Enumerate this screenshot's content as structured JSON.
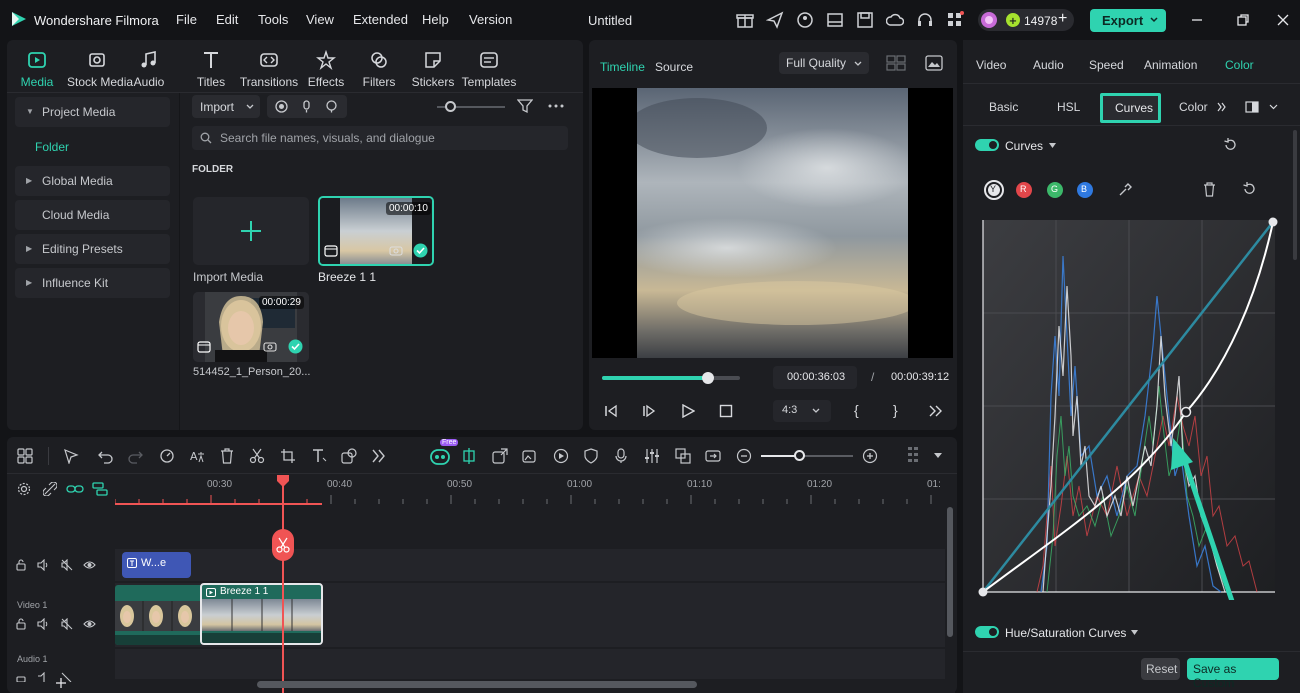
{
  "app": {
    "name": "Wondershare Filmora",
    "menu": [
      "File",
      "Edit",
      "Tools",
      "View",
      "Extended",
      "Help",
      "Version"
    ],
    "doc_title": "Untitled",
    "credits": "14978",
    "export_label": "Export"
  },
  "media": {
    "tabs": [
      "Media",
      "Stock Media",
      "Audio",
      "Titles",
      "Transitions",
      "Effects",
      "Filters",
      "Stickers",
      "Templates"
    ],
    "sidebar": [
      "Project Media",
      "Folder",
      "Global Media",
      "Cloud Media",
      "Editing Presets",
      "Influence Kit"
    ],
    "import_label": "Import",
    "search_placeholder": "Search file names, visuals, and dialogue",
    "folder_label": "FOLDER",
    "import_media_label": "Import Media",
    "clips": [
      {
        "name": "Breeze 1 1",
        "duration": "00:00:10"
      },
      {
        "name": "514452_1_Person_20...",
        "duration": "00:00:29"
      }
    ]
  },
  "player": {
    "tab_timeline": "Timeline",
    "tab_source": "Source",
    "quality": "Full Quality",
    "current_time": "00:00:36:03",
    "separator": "/",
    "total_time": "00:00:39:12",
    "aspect": "4:3",
    "progress": 0.77
  },
  "right": {
    "tabs": [
      "Video",
      "Audio",
      "Speed",
      "Animation",
      "Color"
    ],
    "subtabs": [
      "Basic",
      "HSL",
      "Curves",
      "Color"
    ],
    "curves_label": "Curves",
    "channels": [
      "Y",
      "R",
      "G",
      "B"
    ],
    "hue_sat_label": "Hue/Saturation Curves",
    "reset_label": "Reset",
    "save_custom_label": "Save as Custom"
  },
  "timeline": {
    "ticks": [
      "00:30",
      "00:40",
      "00:50",
      "01:00",
      "01:10",
      "01:20",
      "01:"
    ],
    "title_clip": "W...e",
    "video_clip": "Breeze 1 1",
    "track_video": "Video 1",
    "track_audio": "Audio 1",
    "free_badge": "Free"
  },
  "colors": {
    "accent": "#2fd3b0",
    "playhead": "#f05454",
    "title_clip": "#3f57b5"
  }
}
